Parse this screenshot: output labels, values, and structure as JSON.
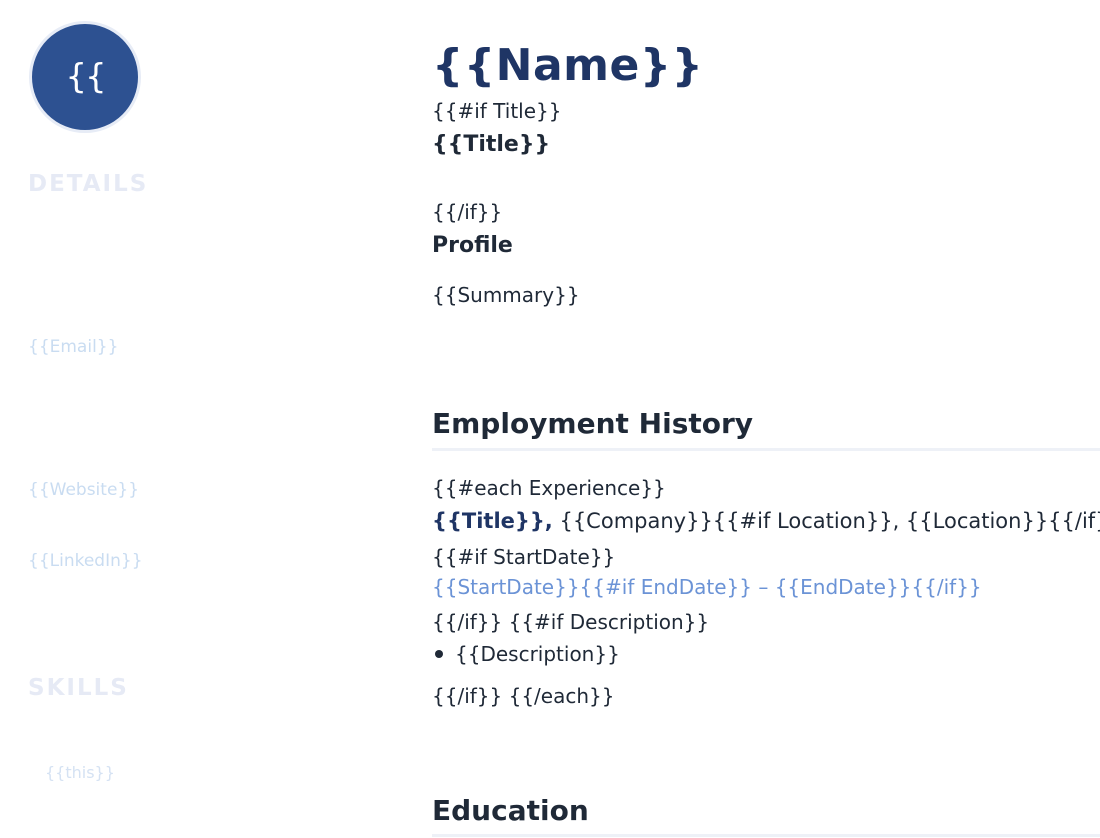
{
  "sidebar": {
    "avatar_initials": "{{",
    "details_heading": "DETAILS",
    "email": "{{Email}}",
    "website": "{{Website}}",
    "linkedin": "{{LinkedIn}}",
    "skills_heading": "SKILLS",
    "skill_item": "{{this}}"
  },
  "main": {
    "name": "{{Name}}",
    "if_title": "{{#if Title}}",
    "title": "{{Title}}",
    "end_if_1": "{{/if}}",
    "profile_heading": "Profile",
    "summary": "{{Summary}}",
    "employment_heading": "Employment History",
    "each_experience": "{{#each Experience}}",
    "exp_title": "{{Title}},",
    "exp_company": " {{Company}}{{#if Location}}, {{Location}}{{/if}}",
    "if_startdate": "{{#if StartDate}}",
    "date_range": "{{StartDate}}{{#if EndDate}} – {{EndDate}}{{/if}}",
    "endif_if_description": "{{/if}} {{#if Description}}",
    "description": "{{Description}}",
    "endif_endeach": "{{/if}} {{/each}}",
    "education_heading": "Education"
  },
  "colors": {
    "accent": "#2d5191",
    "name": "#1f3565",
    "date": "#6b93d6"
  }
}
